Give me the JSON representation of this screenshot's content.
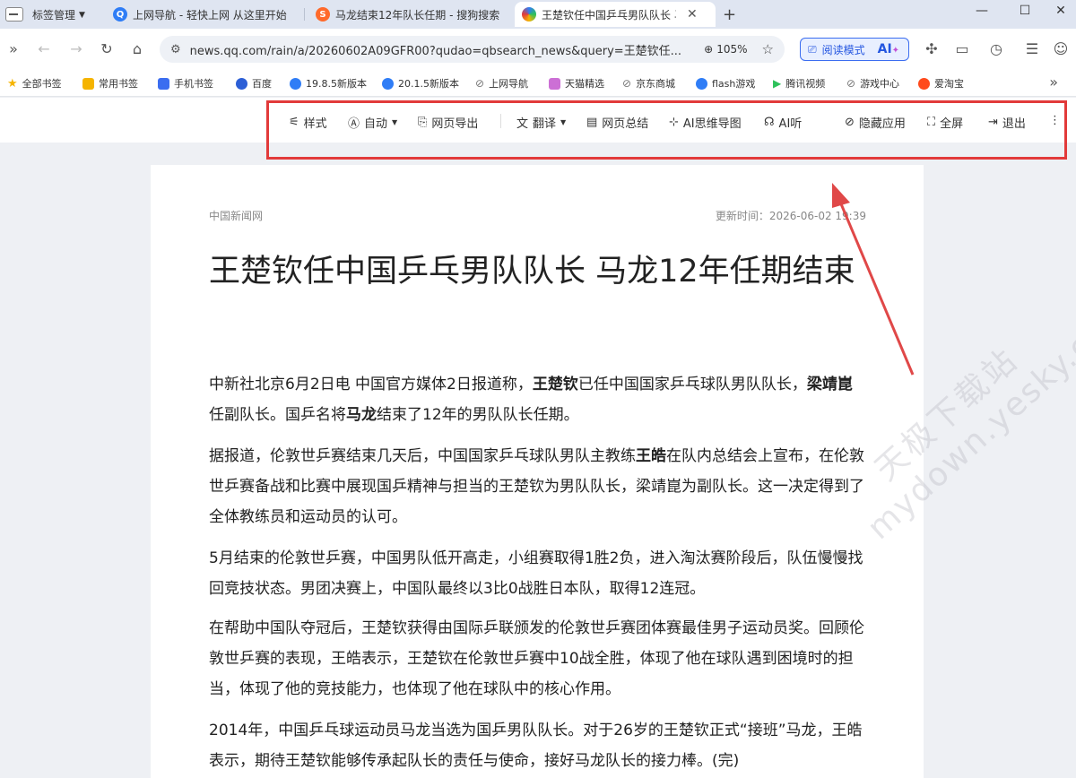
{
  "tabs": {
    "manager_label": "标签管理",
    "items": [
      {
        "title": "上网导航 - 轻快上网 从这里开始"
      },
      {
        "title": "马龙结束12年队长任期 - 搜狗搜索"
      },
      {
        "title": "王楚钦任中国乒乓男队队长 马龙"
      }
    ]
  },
  "nav": {
    "url": "news.qq.com/rain/a/20260602A09GFR00?qudao=qbsearch_news&query=王楚钦任...",
    "zoom": "105%",
    "reader_mode_label": "阅读模式",
    "ai_label": "AI"
  },
  "bookmarks": [
    {
      "label": "全部书签",
      "color": "#f5b400"
    },
    {
      "label": "常用书签",
      "color": "#f5b400"
    },
    {
      "label": "手机书签",
      "color": "#3b6df0"
    },
    {
      "label": "百度",
      "color": "#2c5fd6"
    },
    {
      "label": "19.8.5新版本",
      "color": "#2f7df6"
    },
    {
      "label": "20.1.5新版本",
      "color": "#2f7df6"
    },
    {
      "label": "上网导航",
      "color": "#777777"
    },
    {
      "label": "天猫精选",
      "color": "#cc6fd5"
    },
    {
      "label": "京东商城",
      "color": "#777777"
    },
    {
      "label": "flash游戏",
      "color": "#2f7df6"
    },
    {
      "label": "腾讯视频",
      "color": "#2ec15b"
    },
    {
      "label": "游戏中心",
      "color": "#777777"
    },
    {
      "label": "爱淘宝",
      "color": "#ff4a1c"
    }
  ],
  "reader_toolbar": {
    "style": "样式",
    "auto": "自动",
    "export": "网页导出",
    "translate": "翻译",
    "summary": "网页总结",
    "mindmap": "AI思维导图",
    "listen": "AI听",
    "hide_apps": "隐藏应用",
    "fullscreen": "全屏",
    "exit": "退出"
  },
  "article": {
    "source": "中国新闻网",
    "update_time": "更新时间：2026-06-02 19:39",
    "title": "王楚钦任中国乒乓男队队长 马龙12年任期结束",
    "p1_a": "中新社北京6月2日电 中国官方媒体2日报道称，",
    "p1_b": "王楚钦",
    "p1_c": "已任中国国家乒乓球队男队队长，",
    "p1_d": "梁靖崑",
    "p1_e": "任副队长。国乒名将",
    "p1_f": "马龙",
    "p1_g": "结束了12年的男队队长任期。",
    "p2_a": "据报道，伦敦世乒赛结束几天后，中国国家乒乓球队男队主教练",
    "p2_b": "王皓",
    "p2_c": "在队内总结会上宣布，在伦敦世乒赛备战和比赛中展现国乒精神与担当的王楚钦为男队队长，梁靖崑为副队长。这一决定得到了全体教练员和运动员的认可。",
    "p3": "5月结束的伦敦世乒赛，中国男队低开高走，小组赛取得1胜2负，进入淘汰赛阶段后，队伍慢慢找回竞技状态。男团决赛上，中国队最终以3比0战胜日本队，取得12连冠。",
    "p4": "在帮助中国队夺冠后，王楚钦获得由国际乒联颁发的伦敦世乒赛团体赛最佳男子运动员奖。回顾伦敦世乒赛的表现，王皓表示，王楚钦在伦敦世乒赛中10战全胜，体现了他在球队遇到困境时的担当，体现了他的竞技能力，也体现了他在球队中的核心作用。",
    "p5": "2014年，中国乒乓球运动员马龙当选为国乒男队队长。对于26岁的王楚钦正式“接班”马龙，王皓表示，期待王楚钦能够传承起队长的责任与使命，接好马龙队长的接力棒。(完)"
  },
  "watermark": {
    "line1": "天极下载站",
    "line2": "mydown.yesky.com"
  }
}
